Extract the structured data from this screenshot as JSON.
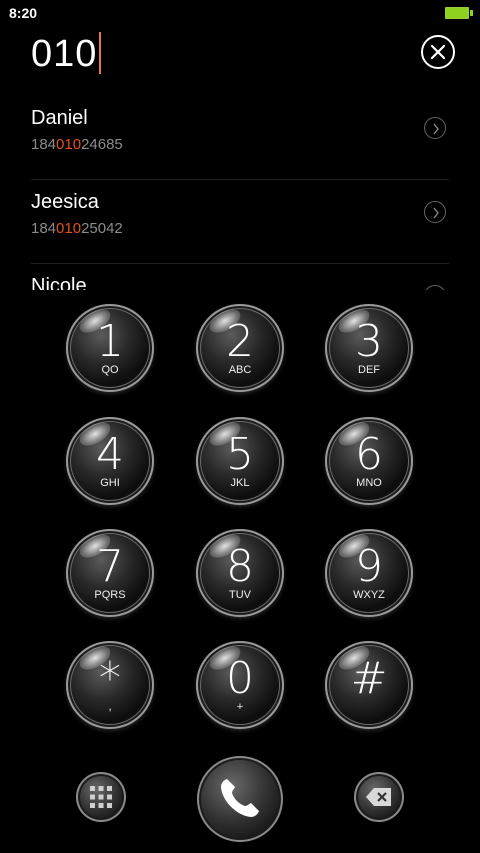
{
  "status_bar": {
    "time": "8:20",
    "battery_level": 1.0,
    "battery_color": "#8fd11f"
  },
  "dial_input": {
    "value": "010",
    "cursor_color": "#f07a1e"
  },
  "contacts": [
    {
      "name": "Daniel",
      "number_prefix": "184",
      "number_match": "010",
      "number_suffix": "24685"
    },
    {
      "name": "Jeesica",
      "number_prefix": "184",
      "number_match": "010",
      "number_suffix": "25042"
    },
    {
      "name": "Nicole",
      "number_prefix": "",
      "number_match": "",
      "number_suffix": ""
    }
  ],
  "highlight_color": "#e35316",
  "keypad": [
    {
      "digit": "1",
      "letters": "QO"
    },
    {
      "digit": "2",
      "letters": "ABC"
    },
    {
      "digit": "3",
      "letters": "DEF"
    },
    {
      "digit": "4",
      "letters": "GHI"
    },
    {
      "digit": "5",
      "letters": "JKL"
    },
    {
      "digit": "6",
      "letters": "MNO"
    },
    {
      "digit": "7",
      "letters": "PQRS"
    },
    {
      "digit": "8",
      "letters": "TUV"
    },
    {
      "digit": "9",
      "letters": "WXYZ"
    },
    {
      "digit": "*",
      "letters": ","
    },
    {
      "digit": "0",
      "letters": "+"
    },
    {
      "digit": "#",
      "letters": ""
    }
  ],
  "actions": {
    "keypad_toggle_icon": "grid-icon",
    "call_icon": "phone-icon",
    "backspace_icon": "backspace-icon"
  }
}
